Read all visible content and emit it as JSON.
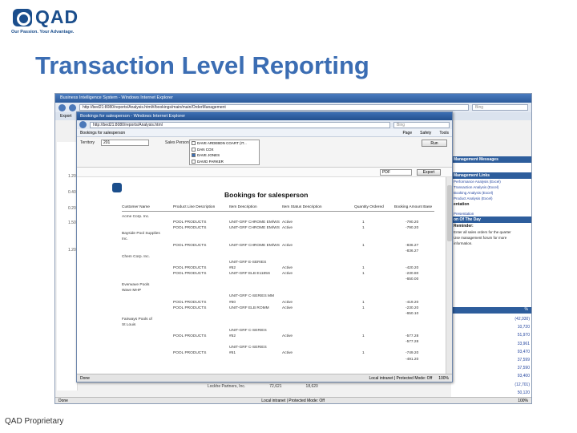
{
  "slide": {
    "logo_text": "QAD",
    "logo_tagline": "Our Passion. Your Advantage.",
    "title": "Transaction Level Reporting",
    "footer": "QAD Proprietary"
  },
  "outer_window": {
    "title": "Business Intelligence System - Windows Internet Explorer",
    "url": "http://bed21:8080/reports/Analysis.html#/bookings/main/main/OrderManagement",
    "search": "Bing",
    "tab": "Export",
    "status_left": "Done",
    "status_right": "Local intranet | Protected Mode: Off",
    "zoom": "100%",
    "right_panel": {
      "header1": "Management Messages",
      "header2": "Management Links",
      "links": [
        "Performance Analysis (Excel)",
        "Transaction Analysis (Excel)",
        "Booking Analysis (Excel)",
        "Product Analysis (Excel)"
      ],
      "section1": "entation",
      "link2": "Presentation",
      "header3": "on Of The Day",
      "reminder": "Reminder:",
      "reminder_lines": [
        "Enter all sales orders for the quarter",
        "Use management forum for more",
        "information."
      ],
      "table_head_left": "",
      "table_head_right": "%",
      "numbers": [
        "(42,930)",
        "10,720",
        "51,970",
        "33,961",
        "93,470",
        "37,599",
        "37,590",
        "93,400",
        "(12,701)",
        "50,120"
      ]
    },
    "axis_values": [
      "1.20",
      "0.40",
      "0.20",
      "1.50",
      "1.20"
    ],
    "bottom_customer": "Lockhe Partners, Inc.",
    "bottom_v1": "72,621",
    "bottom_v2": "18,620"
  },
  "inner_window": {
    "title": "Bookings for salesperson - Windows Internet Explorer",
    "url": "http://bed21:8080/reports/Analysis.html",
    "search": "Bing",
    "tab": "Bookings for salesperson",
    "menu": [
      "Page",
      "Safety",
      "Tools"
    ],
    "filter": {
      "territory_label": "Territory",
      "territory_value": "201",
      "salesperson_label": "Sales Person",
      "options": [
        {
          "label": "DAVE ARDEBDN COART (IT...",
          "checked": false
        },
        {
          "label": "DAN COX",
          "checked": false
        },
        {
          "label": "DAVE JONES",
          "checked": true
        },
        {
          "label": "DAVID PARKER",
          "checked": false
        }
      ],
      "run_label": "Run"
    },
    "format": "PDF",
    "export_label": "Export",
    "status_left": "Done",
    "status_right": "Local intranet | Protected Mode: Off",
    "zoom": "100%",
    "report": {
      "title": "Bookings for salesperson",
      "columns": [
        "Customer Name",
        "Product Line Description",
        "Item Description",
        "Item Status Description",
        "Quantity Ordered",
        "Booking Amount Base"
      ],
      "rows": [
        {
          "customer": "Acme Corp. Inc.",
          "line": "",
          "item": "",
          "status": "",
          "qty": "",
          "amount": ""
        },
        {
          "customer": "",
          "line": "POOL PRODUCTS",
          "item": "UNIT-GRF CHROME EM/WS",
          "status": "Active",
          "qty": "1",
          "amount": "-790.20"
        },
        {
          "customer": "",
          "line": "POOL PRODUCTS",
          "item": "UNIT-GRF CHROME EM/WS",
          "status": "Active",
          "qty": "1",
          "amount": "-790.20"
        },
        {
          "customer": "Bayside Pool Supplies",
          "line": "",
          "item": "",
          "status": "",
          "qty": "",
          "amount": ""
        },
        {
          "customer": "Inc.",
          "line": "",
          "item": "",
          "status": "",
          "qty": "",
          "amount": ""
        },
        {
          "customer": "",
          "line": "POOL PRODUCTS",
          "item": "UNIT-GRF CHROME EM/WS",
          "status": "Active",
          "qty": "1",
          "amount": "-836.27"
        },
        {
          "customer": "",
          "line": "",
          "item": "",
          "status": "",
          "qty": "",
          "amount": "-836.27"
        },
        {
          "customer": "Chem Corp. Inc.",
          "line": "",
          "item": "",
          "status": "",
          "qty": "",
          "amount": ""
        },
        {
          "customer": "",
          "line": "",
          "item": "UNIT-GRF E-SERIES",
          "status": "",
          "qty": "",
          "amount": ""
        },
        {
          "customer": "",
          "line": "POOL PRODUCTS",
          "item": "#62",
          "status": "Active",
          "qty": "1",
          "amount": "-420.20"
        },
        {
          "customer": "",
          "line": "POOL PRODUCTS",
          "item": "UNIT-GRF ELB E1185S",
          "status": "Active",
          "qty": "1",
          "amount": "-230.80"
        },
        {
          "customer": "",
          "line": "",
          "item": "",
          "status": "",
          "qty": "",
          "amount": "-650.00"
        },
        {
          "customer": "Everwave Pools",
          "line": "",
          "item": "",
          "status": "",
          "qty": "",
          "amount": ""
        },
        {
          "customer": "Wave MHP",
          "line": "",
          "item": "",
          "status": "",
          "qty": "",
          "amount": ""
        },
        {
          "customer": "",
          "line": "",
          "item": "UNIT-GRF C-SERIES MM",
          "status": "",
          "qty": "",
          "amount": ""
        },
        {
          "customer": "",
          "line": "POOL PRODUCTS",
          "item": "#60",
          "status": "Active",
          "qty": "1",
          "amount": "-419.20"
        },
        {
          "customer": "",
          "line": "POOL PRODUCTS",
          "item": "UNIT-GRF ELB ROMM",
          "status": "Active",
          "qty": "1",
          "amount": "-230.20"
        },
        {
          "customer": "",
          "line": "",
          "item": "",
          "status": "",
          "qty": "",
          "amount": "-650.10"
        },
        {
          "customer": "Fairways Pools of",
          "line": "",
          "item": "",
          "status": "",
          "qty": "",
          "amount": ""
        },
        {
          "customer": "St Louis",
          "line": "",
          "item": "",
          "status": "",
          "qty": "",
          "amount": ""
        },
        {
          "customer": "",
          "line": "",
          "item": "UNIT-GRF C-SERIES",
          "status": "",
          "qty": "",
          "amount": ""
        },
        {
          "customer": "",
          "line": "POOL PRODUCTS",
          "item": "#52",
          "status": "Active",
          "qty": "1",
          "amount": "-577.28"
        },
        {
          "customer": "",
          "line": "",
          "item": "",
          "status": "",
          "qty": "",
          "amount": "-577.28"
        },
        {
          "customer": "",
          "line": "",
          "item": "UNIT-GRF C-SERIES",
          "status": "",
          "qty": "",
          "amount": ""
        },
        {
          "customer": "",
          "line": "POOL PRODUCTS",
          "item": "#61",
          "status": "Active",
          "qty": "1",
          "amount": "-749.20"
        },
        {
          "customer": "",
          "line": "",
          "item": "",
          "status": "",
          "qty": "",
          "amount": "-491.20"
        }
      ]
    }
  }
}
